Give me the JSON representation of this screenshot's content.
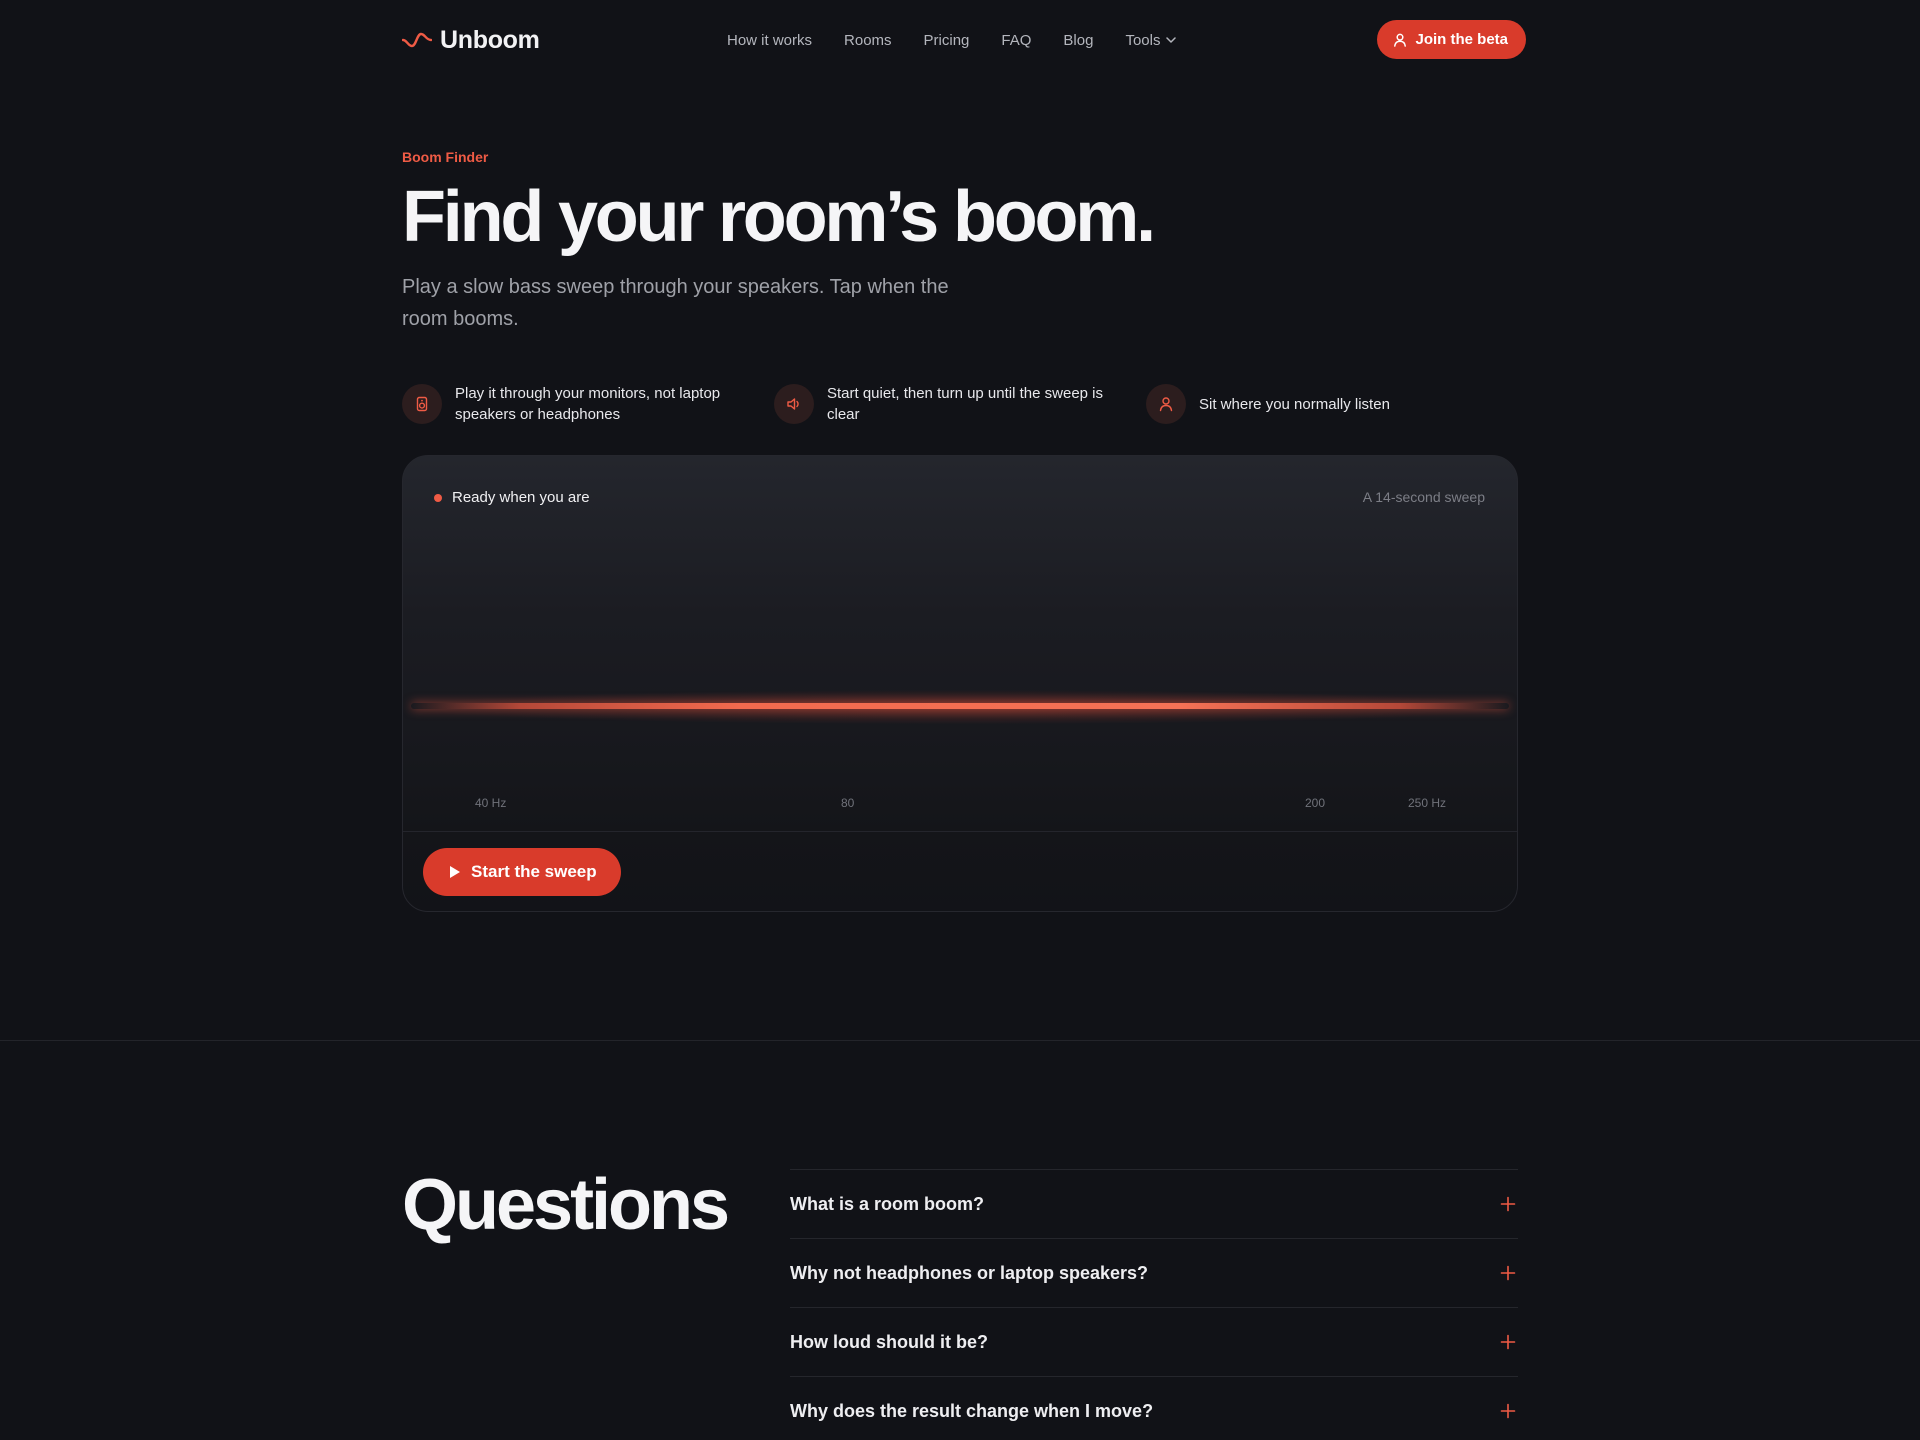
{
  "nav": {
    "brand": "Unboom",
    "links": [
      "How it works",
      "Rooms",
      "Pricing",
      "FAQ",
      "Blog"
    ],
    "tools_label": "Tools",
    "cta_label": "Join the beta"
  },
  "hero": {
    "eyebrow": "Boom Finder",
    "title": "Find your room’s boom.",
    "subtitle": "Play a slow bass sweep through your speakers. Tap when the room booms."
  },
  "tips": [
    {
      "icon": "speaker-icon",
      "text": "Play it through your monitors, not laptop speakers or headphones"
    },
    {
      "icon": "volume-icon",
      "text": "Start quiet, then turn up until the sweep is clear"
    },
    {
      "icon": "listener-icon",
      "text": "Sit where you normally listen"
    }
  ],
  "sweep": {
    "status": "Ready when you are",
    "note": "A 14-second sweep",
    "axis_labels": [
      "40 Hz",
      "80",
      "200",
      "250 Hz"
    ],
    "start_label": "Start the sweep"
  },
  "faq": {
    "title": "Questions",
    "items": [
      "What is a room boom?",
      "Why not headphones or laptop speakers?",
      "How loud should it be?",
      "Why does the result change when I move?"
    ]
  },
  "colors": {
    "accent": "#d93b2b",
    "accent_text": "#ef5b45",
    "background": "#111217"
  }
}
